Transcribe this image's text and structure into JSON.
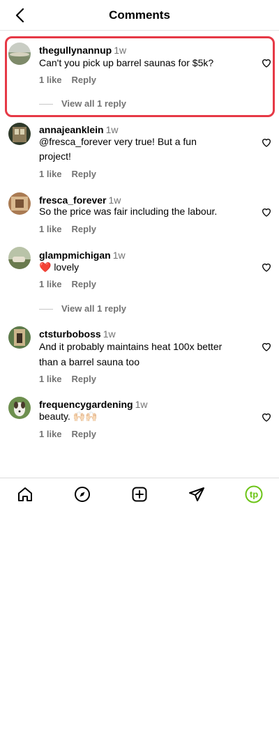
{
  "header": {
    "title": "Comments",
    "back_icon": "chevron-left-icon"
  },
  "comments": [
    {
      "username": "thegullynannup",
      "time": "1w",
      "text": "Can't you pick up barrel saunas for $5k?",
      "likes": "1 like",
      "reply": "Reply",
      "view_replies": "View all 1 reply",
      "highlighted": true
    },
    {
      "username": "annajeanklein",
      "time": "1w",
      "text": "@fresca_forever very true! But a fun project!",
      "likes": "1 like",
      "reply": "Reply"
    },
    {
      "username": "fresca_forever",
      "time": "1w",
      "text": "So the price was fair including the labour.",
      "likes": "1 like",
      "reply": "Reply"
    },
    {
      "username": "glampmichigan",
      "time": "1w",
      "text": "❤️ lovely",
      "likes": "1 like",
      "reply": "Reply",
      "view_replies": "View all 1 reply"
    },
    {
      "username": "ctsturboboss",
      "time": "1w",
      "text": "And it probably maintains heat 100x better than a barrel sauna too",
      "likes": "1 like",
      "reply": "Reply"
    },
    {
      "username": "frequencygardening",
      "time": "1w",
      "text": "beauty. 🙌🏻🙌🏻",
      "likes": "1 like",
      "reply": "Reply"
    }
  ],
  "nav": {
    "items": [
      "home-icon",
      "explore-icon",
      "create-icon",
      "direct-messages-icon",
      "profile-avatar"
    ],
    "profile_initials": "tp",
    "profile_color": "#6cc417"
  },
  "colors": {
    "highlight": "#e63946",
    "secondary_text": "#737373"
  }
}
